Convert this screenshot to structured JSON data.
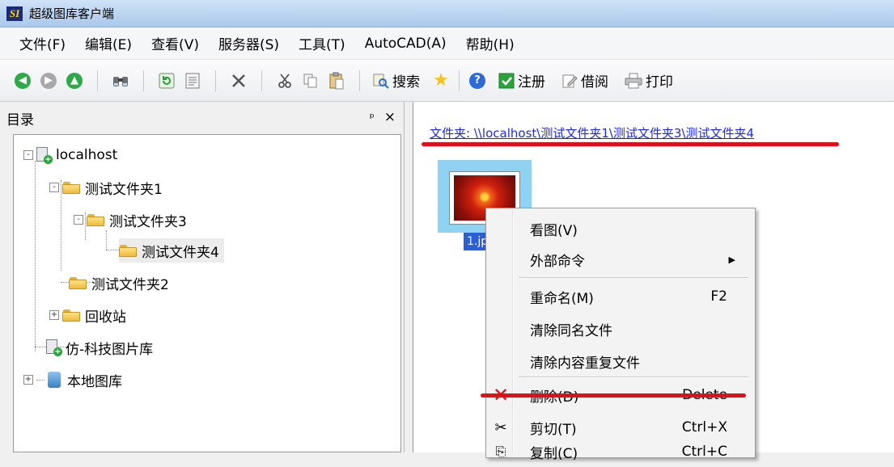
{
  "window": {
    "title": "超级图库客户端",
    "icon_text": "SI"
  },
  "menu": [
    {
      "label": "文件(F)"
    },
    {
      "label": "编辑(E)"
    },
    {
      "label": "查看(V)"
    },
    {
      "label": "服务器(S)"
    },
    {
      "label": "工具(T)"
    },
    {
      "label": "AutoCAD(A)"
    },
    {
      "label": "帮助(H)"
    }
  ],
  "toolbar": {
    "search_label": "搜索",
    "register_label": "注册",
    "borrow_label": "借阅",
    "print_label": "打印",
    "colors": {
      "back": "#2ea94a",
      "forward": "#9a9a9a",
      "up": "#2ea94a",
      "help": "#2b6ad8"
    }
  },
  "left_pane": {
    "title": "目录",
    "pin_icon": "pin-icon",
    "close_symbol": "×",
    "tree": [
      {
        "label": "localhost",
        "icon": "server-icon",
        "expander": "-"
      },
      {
        "label": "测试文件夹1",
        "icon": "folder-icon",
        "expander": "-"
      },
      {
        "label": "测试文件夹3",
        "icon": "folder-icon",
        "expander": "-"
      },
      {
        "label": "测试文件夹4",
        "icon": "folder-icon",
        "selected": true
      },
      {
        "label": "测试文件夹2",
        "icon": "folder-icon"
      },
      {
        "label": "回收站",
        "icon": "folder-icon",
        "expander": "+"
      },
      {
        "label": "仿-科技图片库",
        "icon": "server-icon"
      },
      {
        "label": "本地图库",
        "icon": "monitor-icon",
        "expander": "+"
      }
    ]
  },
  "right_pane": {
    "path_text": "文件夹: \\\\localhost\\测试文件夹1\\测试文件夹3\\测试文件夹4",
    "thumbnail_label": "1.jp",
    "annotation_color": "#e0101a"
  },
  "context_menu": {
    "items": [
      {
        "label": "看图(V)",
        "shortcut": ""
      },
      {
        "label": "外部命令",
        "shortcut": "",
        "submenu": true
      },
      {
        "label": "重命名(M)",
        "shortcut": "F2"
      },
      {
        "label": "清除同名文件",
        "shortcut": ""
      },
      {
        "label": "清除内容重复文件",
        "shortcut": ""
      },
      {
        "label": "删除(D)",
        "shortcut": "Delete",
        "icon": "delete-x-icon"
      },
      {
        "label": "剪切(T)",
        "shortcut": "Ctrl+X",
        "icon": "scissors-icon"
      },
      {
        "label": "复制(C)",
        "shortcut": "Ctrl+C",
        "icon": "copy-icon"
      }
    ]
  }
}
